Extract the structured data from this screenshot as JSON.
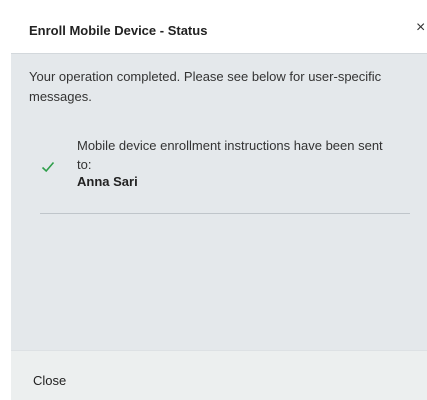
{
  "dialog": {
    "title": "Enroll Mobile Device - Status",
    "close_glyph": "×",
    "summary": "Your operation completed. Please see below for user-specific messages.",
    "message": {
      "status_icon": "checkmark-icon",
      "status_color": "#2e9e4a",
      "text": "Mobile device enrollment instructions have been sent to:",
      "user": "Anna Sari"
    },
    "footer": {
      "close_label": "Close"
    }
  }
}
